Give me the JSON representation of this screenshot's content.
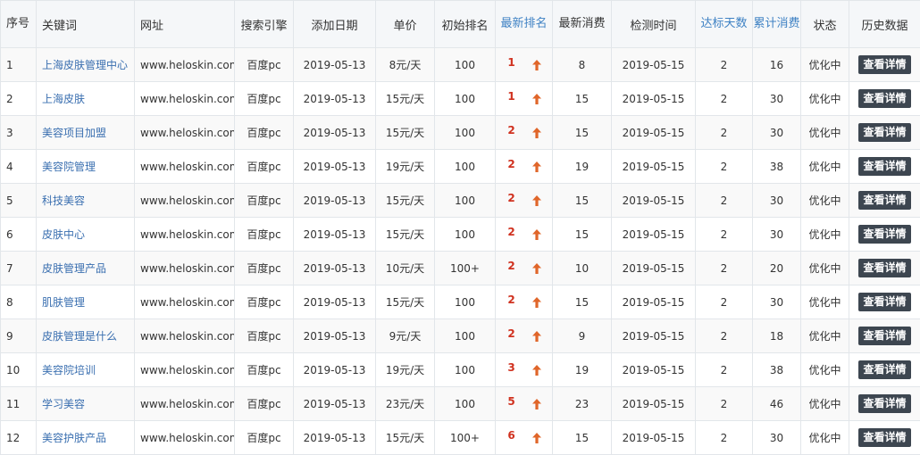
{
  "headers": {
    "seq": "序号",
    "keyword": "关键词",
    "url": "网址",
    "engine": "搜索引擎",
    "date_added": "添加日期",
    "price": "单价",
    "initial_rank": "初始排名",
    "latest_rank": "最新排名",
    "latest_cost": "最新消费",
    "check_time": "检测时间",
    "days_reached": "达标天数",
    "total_cost": "累计消费",
    "status": "状态",
    "history": "历史数据"
  },
  "colors": {
    "link_blue": "#3a6fb0",
    "rank_red": "#d0311f",
    "arrow_orange": "#e0662a",
    "button_dark": "#3d4650"
  },
  "rows": [
    {
      "seq": "1",
      "keyword": "上海皮肤管理中心",
      "url": "www.heloskin.com",
      "engine": "百度pc",
      "date_added": "2019-05-13",
      "price": "8元/天",
      "initial_rank": "100",
      "latest_rank": "1",
      "latest_cost": "8",
      "check_time": "2019-05-15",
      "days_reached": "2",
      "total_cost": "16",
      "status": "优化中",
      "action": "查看详情"
    },
    {
      "seq": "2",
      "keyword": "上海皮肤",
      "url": "www.heloskin.com",
      "engine": "百度pc",
      "date_added": "2019-05-13",
      "price": "15元/天",
      "initial_rank": "100",
      "latest_rank": "1",
      "latest_cost": "15",
      "check_time": "2019-05-15",
      "days_reached": "2",
      "total_cost": "30",
      "status": "优化中",
      "action": "查看详情"
    },
    {
      "seq": "3",
      "keyword": "美容项目加盟",
      "url": "www.heloskin.com",
      "engine": "百度pc",
      "date_added": "2019-05-13",
      "price": "15元/天",
      "initial_rank": "100",
      "latest_rank": "2",
      "latest_cost": "15",
      "check_time": "2019-05-15",
      "days_reached": "2",
      "total_cost": "30",
      "status": "优化中",
      "action": "查看详情"
    },
    {
      "seq": "4",
      "keyword": "美容院管理",
      "url": "www.heloskin.com",
      "engine": "百度pc",
      "date_added": "2019-05-13",
      "price": "19元/天",
      "initial_rank": "100",
      "latest_rank": "2",
      "latest_cost": "19",
      "check_time": "2019-05-15",
      "days_reached": "2",
      "total_cost": "38",
      "status": "优化中",
      "action": "查看详情"
    },
    {
      "seq": "5",
      "keyword": "科技美容",
      "url": "www.heloskin.com",
      "engine": "百度pc",
      "date_added": "2019-05-13",
      "price": "15元/天",
      "initial_rank": "100",
      "latest_rank": "2",
      "latest_cost": "15",
      "check_time": "2019-05-15",
      "days_reached": "2",
      "total_cost": "30",
      "status": "优化中",
      "action": "查看详情"
    },
    {
      "seq": "6",
      "keyword": "皮肤中心",
      "url": "www.heloskin.com",
      "engine": "百度pc",
      "date_added": "2019-05-13",
      "price": "15元/天",
      "initial_rank": "100",
      "latest_rank": "2",
      "latest_cost": "15",
      "check_time": "2019-05-15",
      "days_reached": "2",
      "total_cost": "30",
      "status": "优化中",
      "action": "查看详情"
    },
    {
      "seq": "7",
      "keyword": "皮肤管理产品",
      "url": "www.heloskin.com",
      "engine": "百度pc",
      "date_added": "2019-05-13",
      "price": "10元/天",
      "initial_rank": "100+",
      "latest_rank": "2",
      "latest_cost": "10",
      "check_time": "2019-05-15",
      "days_reached": "2",
      "total_cost": "20",
      "status": "优化中",
      "action": "查看详情"
    },
    {
      "seq": "8",
      "keyword": "肌肤管理",
      "url": "www.heloskin.com",
      "engine": "百度pc",
      "date_added": "2019-05-13",
      "price": "15元/天",
      "initial_rank": "100",
      "latest_rank": "2",
      "latest_cost": "15",
      "check_time": "2019-05-15",
      "days_reached": "2",
      "total_cost": "30",
      "status": "优化中",
      "action": "查看详情"
    },
    {
      "seq": "9",
      "keyword": "皮肤管理是什么",
      "url": "www.heloskin.com",
      "engine": "百度pc",
      "date_added": "2019-05-13",
      "price": "9元/天",
      "initial_rank": "100",
      "latest_rank": "2",
      "latest_cost": "9",
      "check_time": "2019-05-15",
      "days_reached": "2",
      "total_cost": "18",
      "status": "优化中",
      "action": "查看详情"
    },
    {
      "seq": "10",
      "keyword": "美容院培训",
      "url": "www.heloskin.com",
      "engine": "百度pc",
      "date_added": "2019-05-13",
      "price": "19元/天",
      "initial_rank": "100",
      "latest_rank": "3",
      "latest_cost": "19",
      "check_time": "2019-05-15",
      "days_reached": "2",
      "total_cost": "38",
      "status": "优化中",
      "action": "查看详情"
    },
    {
      "seq": "11",
      "keyword": "学习美容",
      "url": "www.heloskin.com",
      "engine": "百度pc",
      "date_added": "2019-05-13",
      "price": "23元/天",
      "initial_rank": "100",
      "latest_rank": "5",
      "latest_cost": "23",
      "check_time": "2019-05-15",
      "days_reached": "2",
      "total_cost": "46",
      "status": "优化中",
      "action": "查看详情"
    },
    {
      "seq": "12",
      "keyword": "美容护肤产品",
      "url": "www.heloskin.com",
      "engine": "百度pc",
      "date_added": "2019-05-13",
      "price": "15元/天",
      "initial_rank": "100+",
      "latest_rank": "6",
      "latest_cost": "15",
      "check_time": "2019-05-15",
      "days_reached": "2",
      "total_cost": "30",
      "status": "优化中",
      "action": "查看详情"
    }
  ]
}
